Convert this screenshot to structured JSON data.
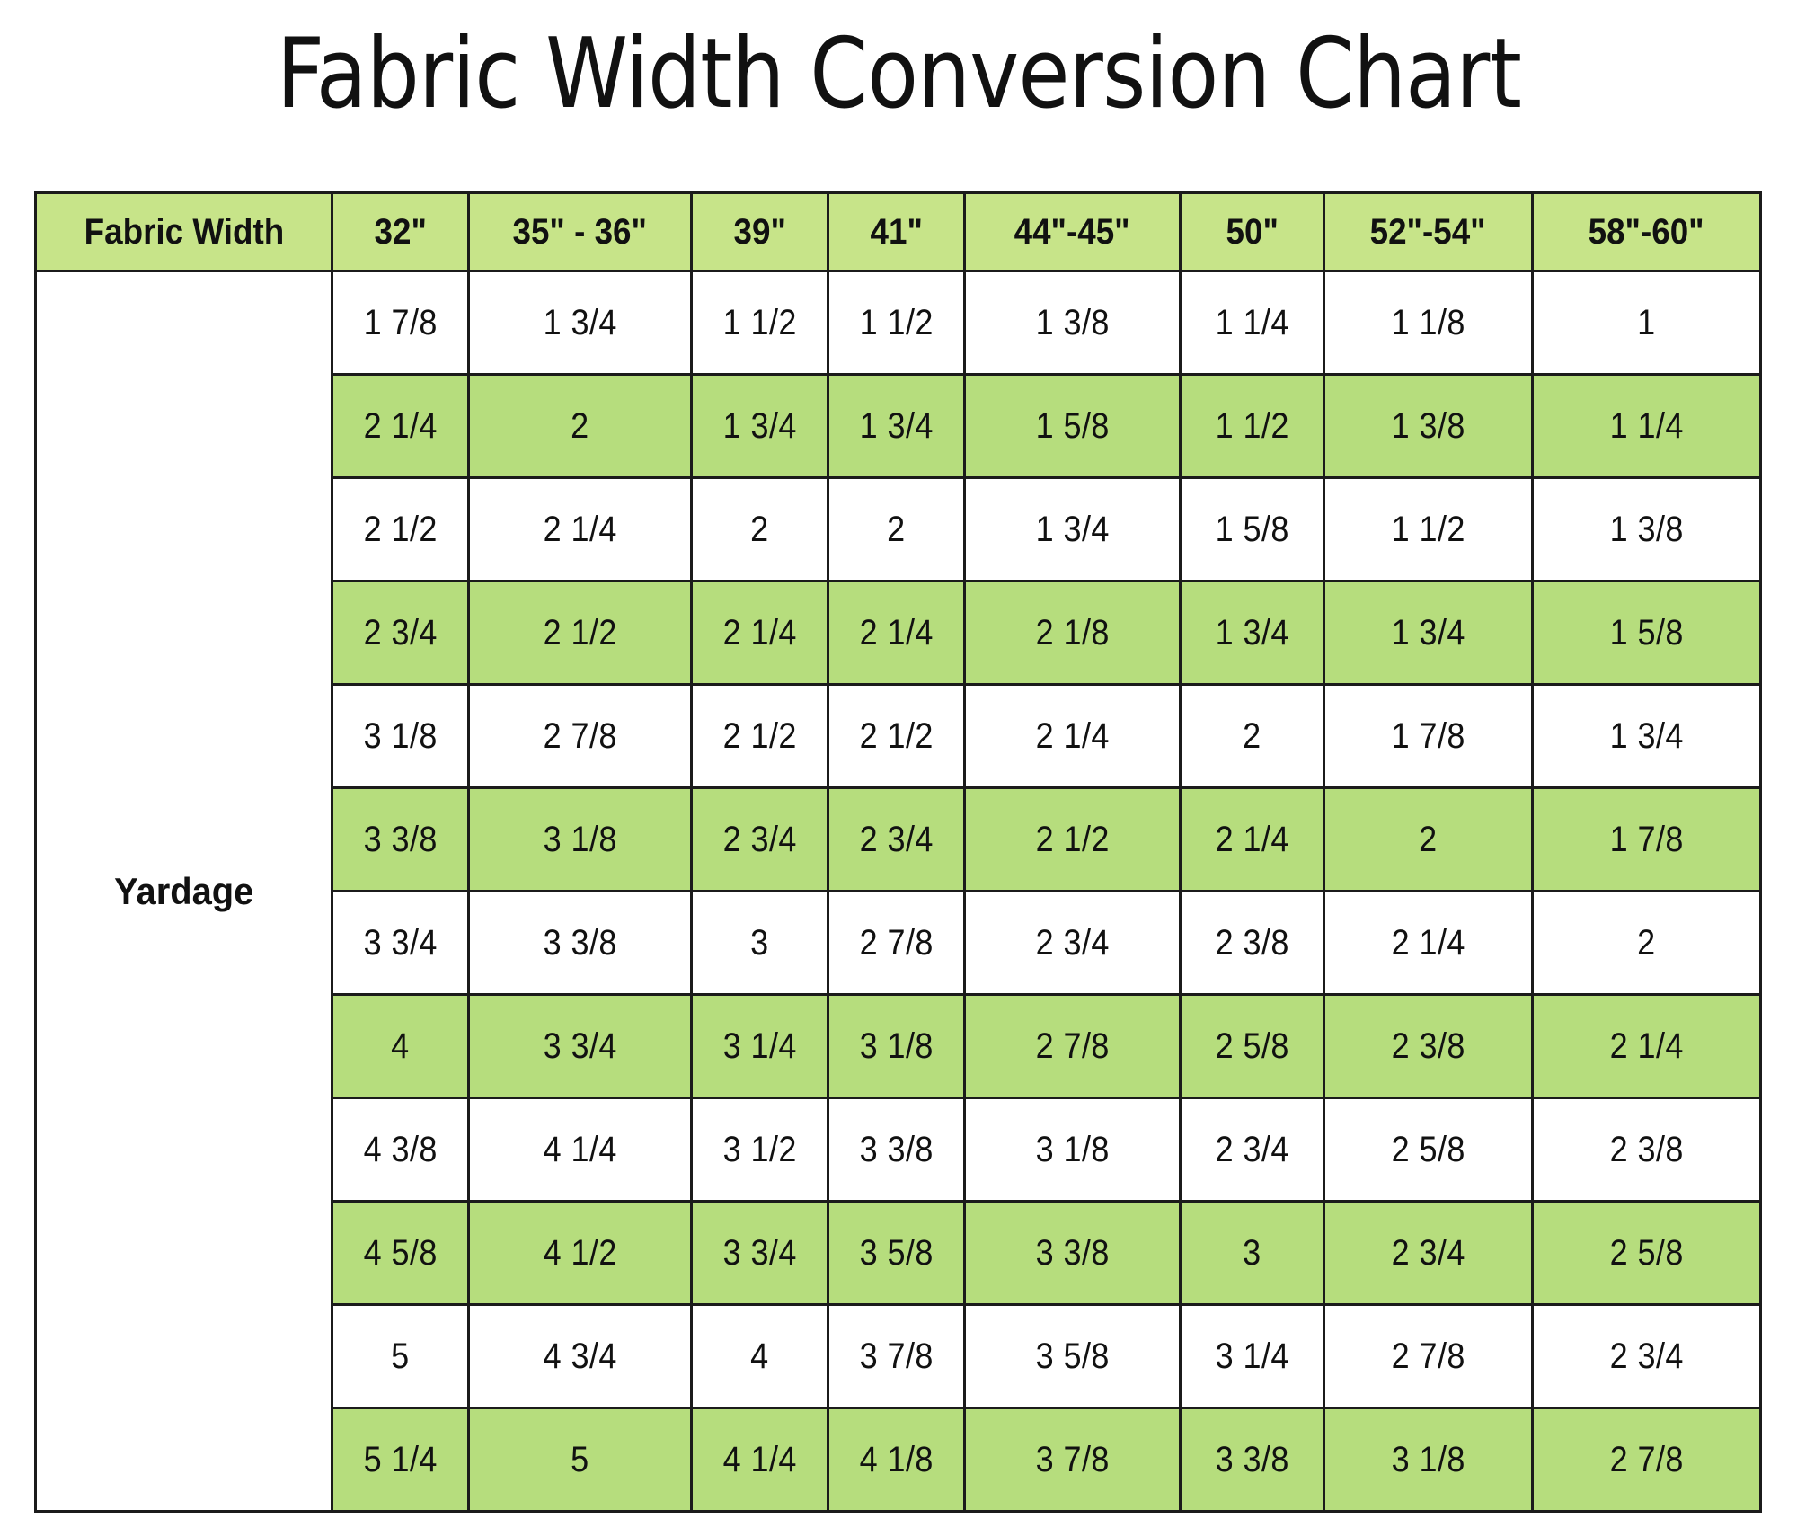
{
  "document": {
    "title": "Fabric Width Conversion Chart"
  },
  "table": {
    "row_label_header": "Fabric Width",
    "row_label": "Yardage",
    "column_headers": [
      "32\"",
      "35\" - 36\"",
      "39\"",
      "41\"",
      "44\"-45\"",
      "50\"",
      "52\"-54\"",
      "58\"-60\""
    ],
    "colors": {
      "header_green": "#c7e489",
      "row_green": "#b6dd7d",
      "border": "#1b1b1b",
      "text": "#111111",
      "background": "#ffffff"
    },
    "rows": [
      {
        "shaded": false,
        "values": [
          "1 7/8",
          "1 3/4",
          "1 1/2",
          "1 1/2",
          "1 3/8",
          "1 1/4",
          "1 1/8",
          "1"
        ]
      },
      {
        "shaded": true,
        "values": [
          "2 1/4",
          "2",
          "1 3/4",
          "1 3/4",
          "1 5/8",
          "1 1/2",
          "1 3/8",
          "1 1/4"
        ]
      },
      {
        "shaded": false,
        "values": [
          "2 1/2",
          "2 1/4",
          "2",
          "2",
          "1 3/4",
          "1 5/8",
          "1 1/2",
          "1 3/8"
        ]
      },
      {
        "shaded": true,
        "values": [
          "2 3/4",
          "2 1/2",
          "2 1/4",
          "2 1/4",
          "2 1/8",
          "1 3/4",
          "1 3/4",
          "1 5/8"
        ]
      },
      {
        "shaded": false,
        "values": [
          "3 1/8",
          "2 7/8",
          "2 1/2",
          "2 1/2",
          "2 1/4",
          "2",
          "1 7/8",
          "1 3/4"
        ]
      },
      {
        "shaded": true,
        "values": [
          "3 3/8",
          "3 1/8",
          "2 3/4",
          "2 3/4",
          "2 1/2",
          "2 1/4",
          "2",
          "1 7/8"
        ]
      },
      {
        "shaded": false,
        "values": [
          "3 3/4",
          "3 3/8",
          "3",
          "2 7/8",
          "2 3/4",
          "2 3/8",
          "2 1/4",
          "2"
        ]
      },
      {
        "shaded": true,
        "values": [
          "4",
          "3 3/4",
          "3 1/4",
          "3 1/8",
          "2 7/8",
          "2 5/8",
          "2 3/8",
          "2 1/4"
        ]
      },
      {
        "shaded": false,
        "values": [
          "4 3/8",
          "4 1/4",
          "3 1/2",
          "3 3/8",
          "3 1/8",
          "2 3/4",
          "2 5/8",
          "2 3/8"
        ]
      },
      {
        "shaded": true,
        "values": [
          "4 5/8",
          "4 1/2",
          "3 3/4",
          "3 5/8",
          "3 3/8",
          "3",
          "2 3/4",
          "2 5/8"
        ]
      },
      {
        "shaded": false,
        "values": [
          "5",
          "4 3/4",
          "4",
          "3 7/8",
          "3 5/8",
          "3 1/4",
          "2 7/8",
          "2 3/4"
        ]
      },
      {
        "shaded": true,
        "values": [
          "5 1/4",
          "5",
          "4 1/4",
          "4 1/8",
          "3 7/8",
          "3 3/8",
          "3 1/8",
          "2 7/8"
        ]
      }
    ]
  }
}
